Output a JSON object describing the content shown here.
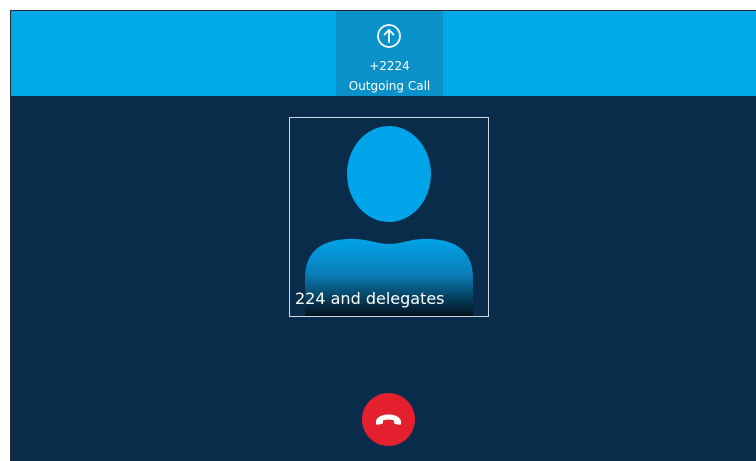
{
  "call": {
    "number": "+2224",
    "status": "Outgoing Call",
    "direction_icon": "arrow-up-circle-icon"
  },
  "contact": {
    "name": "224 and delegates",
    "avatar_icon": "person-silhouette-icon"
  },
  "controls": {
    "end_call_icon": "phone-hangup-icon"
  },
  "colors": {
    "top_bar": "#00aaea",
    "active_tab": "#0a91c9",
    "background": "#082c4a",
    "avatar": "#00a4e8",
    "end_call": "#e4202f"
  }
}
